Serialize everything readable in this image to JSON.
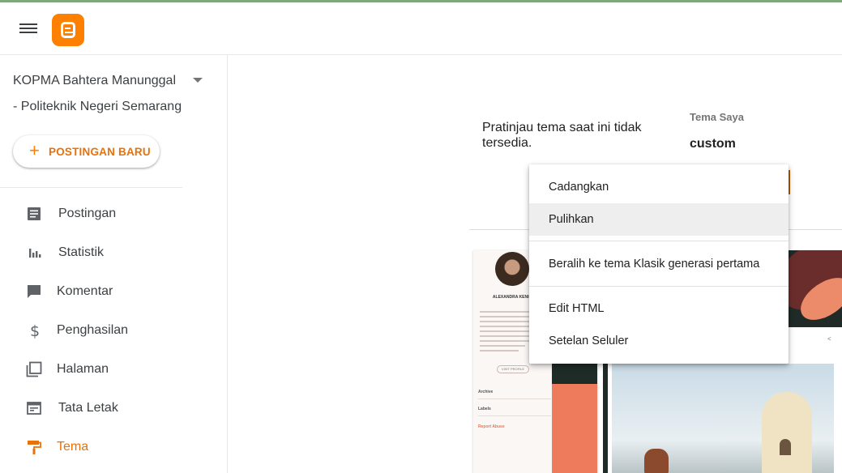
{
  "header": {
    "menu_icon": "hamburger-menu-icon",
    "logo_icon": "blogger-logo-icon",
    "logo_color": "#ff8000"
  },
  "sidebar": {
    "blog_name": "KOPMA Bahtera Manunggal - Politeknik Negeri Semarang",
    "new_post_label": "POSTINGAN BARU",
    "items": [
      {
        "label": "Postingan",
        "icon": "posts-icon"
      },
      {
        "label": "Statistik",
        "icon": "stats-icon"
      },
      {
        "label": "Komentar",
        "icon": "comment-icon"
      },
      {
        "label": "Penghasilan",
        "icon": "dollar-icon"
      },
      {
        "label": "Halaman",
        "icon": "pages-icon"
      },
      {
        "label": "Tata Letak",
        "icon": "layout-icon"
      },
      {
        "label": "Tema",
        "icon": "paint-roller-icon",
        "active": true
      }
    ],
    "accent_color": "#e8710a"
  },
  "main": {
    "preview_message": "Pratinjau tema saat ini tidak tersedia.",
    "my_theme_label": "Tema Saya",
    "my_theme_name": "custom"
  },
  "thumbnail": {
    "name": "ALEXANDRA KENIN",
    "visit_label": "VISIT PROFILE",
    "archive_label": "Archive",
    "labels_label": "Labels",
    "report_label": "Report Abuse"
  },
  "menu": {
    "items": [
      {
        "label": "Cadangkan"
      },
      {
        "label": "Pulihkan",
        "hovered": true
      },
      {
        "label": "Beralih ke tema Klasik generasi pertama"
      },
      {
        "label": "Edit HTML"
      },
      {
        "label": "Setelan Seluler"
      }
    ]
  }
}
